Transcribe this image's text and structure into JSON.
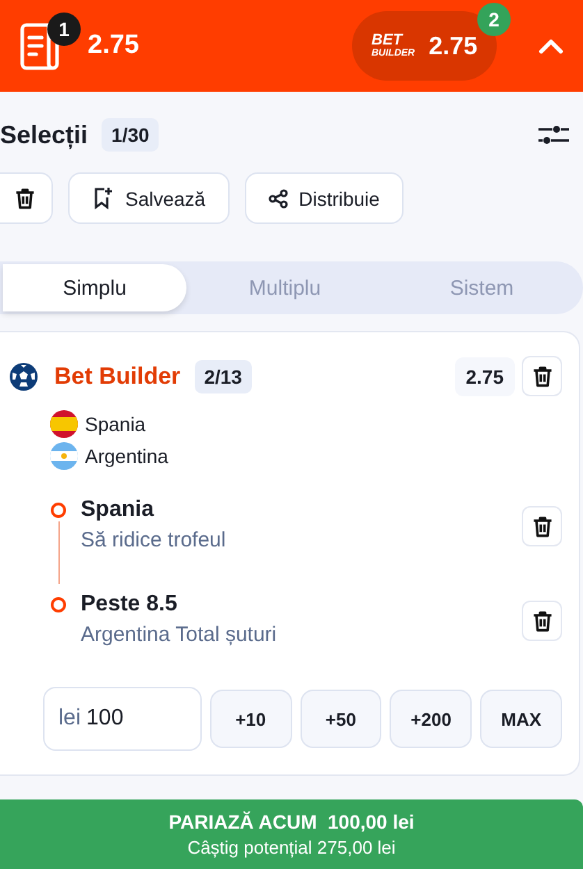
{
  "header": {
    "bets_count": "1",
    "total_odds": "2.75",
    "builder": {
      "logo_top": "BET",
      "logo_bottom": "BUILDER",
      "odds": "2.75",
      "count": "2"
    }
  },
  "selections_header": {
    "title": "Selecții",
    "count": "1/30"
  },
  "actions": [
    {
      "kind": "delete"
    },
    {
      "kind": "save",
      "label": "Salvează"
    },
    {
      "kind": "share",
      "label": "Distribuie"
    }
  ],
  "tabs": [
    {
      "label": "Simplu",
      "selected": true
    },
    {
      "label": "Multiplu",
      "selected": false
    },
    {
      "label": "Sistem",
      "selected": false
    }
  ],
  "bet": {
    "title": "Bet Builder",
    "count": "2/13",
    "odds": "2.75",
    "teams": [
      {
        "name": "Spania",
        "kind": "spain"
      },
      {
        "name": "Argentina",
        "kind": "argentina"
      }
    ],
    "legs": [
      {
        "title": "Spania",
        "subtitle": "Să ridice trofeul"
      },
      {
        "title": "Peste 8.5",
        "subtitle": "Argentina Total șuturi"
      }
    ]
  },
  "stake": {
    "prefix": "lei",
    "value": "100"
  },
  "quick_amounts": [
    "+10",
    "+50",
    "+200",
    "MAX"
  ],
  "place_bet": {
    "label": "PARIAZĂ ACUM  100,00 lei",
    "potential": "Câștig potențial 275,00 lei"
  }
}
